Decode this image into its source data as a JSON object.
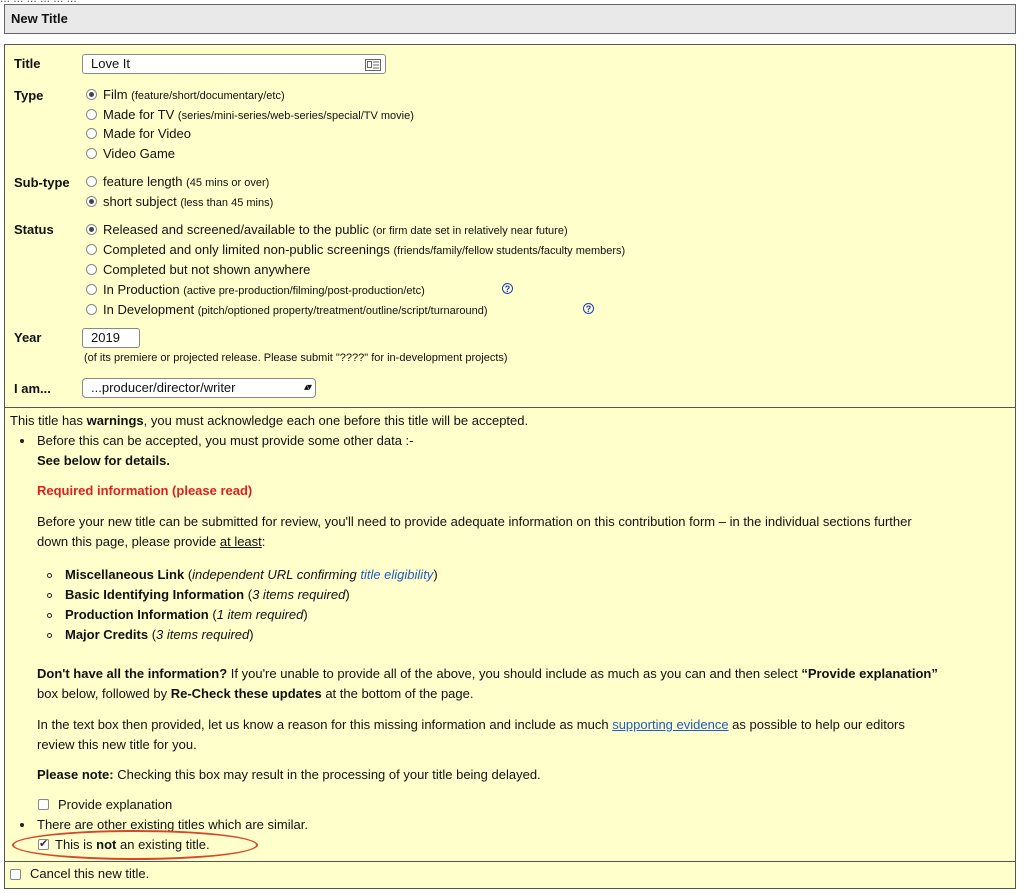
{
  "top_cut_text": "... ... ... ... ... ...",
  "header": {
    "title": "New Title"
  },
  "form": {
    "title_label": "Title",
    "title_value": "Love It",
    "type_label": "Type",
    "type_options": [
      {
        "main": "Film",
        "hint": "(feature/short/documentary/etc)",
        "selected": true
      },
      {
        "main": "Made for TV",
        "hint": "(series/mini-series/web-series/special/TV movie)",
        "selected": false
      },
      {
        "main": "Made for Video",
        "hint": "",
        "selected": false
      },
      {
        "main": "Video Game",
        "hint": "",
        "selected": false
      }
    ],
    "subtype_label": "Sub-type",
    "subtype_options": [
      {
        "main": "feature length",
        "hint": "(45 mins or over)",
        "selected": false
      },
      {
        "main": "short subject",
        "hint": "(less than 45 mins)",
        "selected": true
      }
    ],
    "status_label": "Status",
    "status_options": [
      {
        "main": "Released and screened/available to the public",
        "hint": "(or firm date set in relatively near future)",
        "selected": true
      },
      {
        "main": "Completed and only limited non-public screenings",
        "hint": "(friends/family/fellow students/faculty members)",
        "selected": false
      },
      {
        "main": "Completed but not shown anywhere",
        "hint": "",
        "selected": false
      },
      {
        "main": "In Production",
        "hint": "(active pre-production/filming/post-production/etc)",
        "selected": false
      },
      {
        "main": "In Development",
        "hint": "(pitch/optioned property/treatment/outline/script/turnaround)",
        "selected": false
      }
    ],
    "help_glyph": "?",
    "year_label": "Year",
    "year_value": "2019",
    "year_hint": "(of its premiere or projected release. Please submit \"????\" for in-development projects)",
    "iam_label": "I am...",
    "iam_value": "...producer/director/writer",
    "select_arrows": "▴▾"
  },
  "warnings": {
    "intro_pre": "This title has ",
    "intro_bold": "warnings",
    "intro_post": ", you must acknowledge each one before this title will be accepted.",
    "item1": "Before this can be accepted, you must provide some other data :-",
    "see_below": "See below for details.",
    "required_heading": "Required information (please read)",
    "para1_line1": "Before your new title can be submitted for review, you'll need to provide adequate information on this contribution form – in the individual sections further",
    "para1_line2_pre": "down this page, please provide ",
    "para1_line2_u": "at least",
    "para1_line2_post": ":",
    "req_list": [
      {
        "bold": "Miscellaneous Link",
        "italic_pre": "(",
        "italic": "independent URL confirming ",
        "link": "title eligibility",
        "italic_post": ")"
      },
      {
        "bold": "Basic Identifying Information",
        "italic_pre": "(",
        "italic": "3 items required",
        "link": "",
        "italic_post": ")"
      },
      {
        "bold": "Production Information",
        "italic_pre": "(",
        "italic": "1 item required",
        "link": "",
        "italic_post": ")"
      },
      {
        "bold": "Major Credits",
        "italic_pre": "(",
        "italic": "3 items required",
        "link": "",
        "italic_post": ")"
      }
    ],
    "para2_bold": "Don't have all the information?",
    "para2_rest": " If you're unable to provide all of the above, you should include as much as you can and then select ",
    "para2_quote": "“Provide explanation”",
    "para2_line2_pre": "box below, followed by ",
    "para2_line2_bold": "Re-Check these updates",
    "para2_line2_post": " at the bottom of the page.",
    "para3_line1_pre": "In the text box then provided, let us know a reason for this missing information and include as much ",
    "para3_link": "supporting evidence",
    "para3_line1_post": " as possible to help our editors",
    "para3_line2": "review this new title for you.",
    "note_bold": "Please note:",
    "note_rest": " Checking this box may result in the processing of your title being delayed.",
    "provide_explanation": "Provide explanation",
    "item2": "There are other existing titles which are similar.",
    "not_existing_pre": "This is ",
    "not_existing_bold": "not",
    "not_existing_post": " an existing title."
  },
  "cancel_label": "Cancel this new title."
}
